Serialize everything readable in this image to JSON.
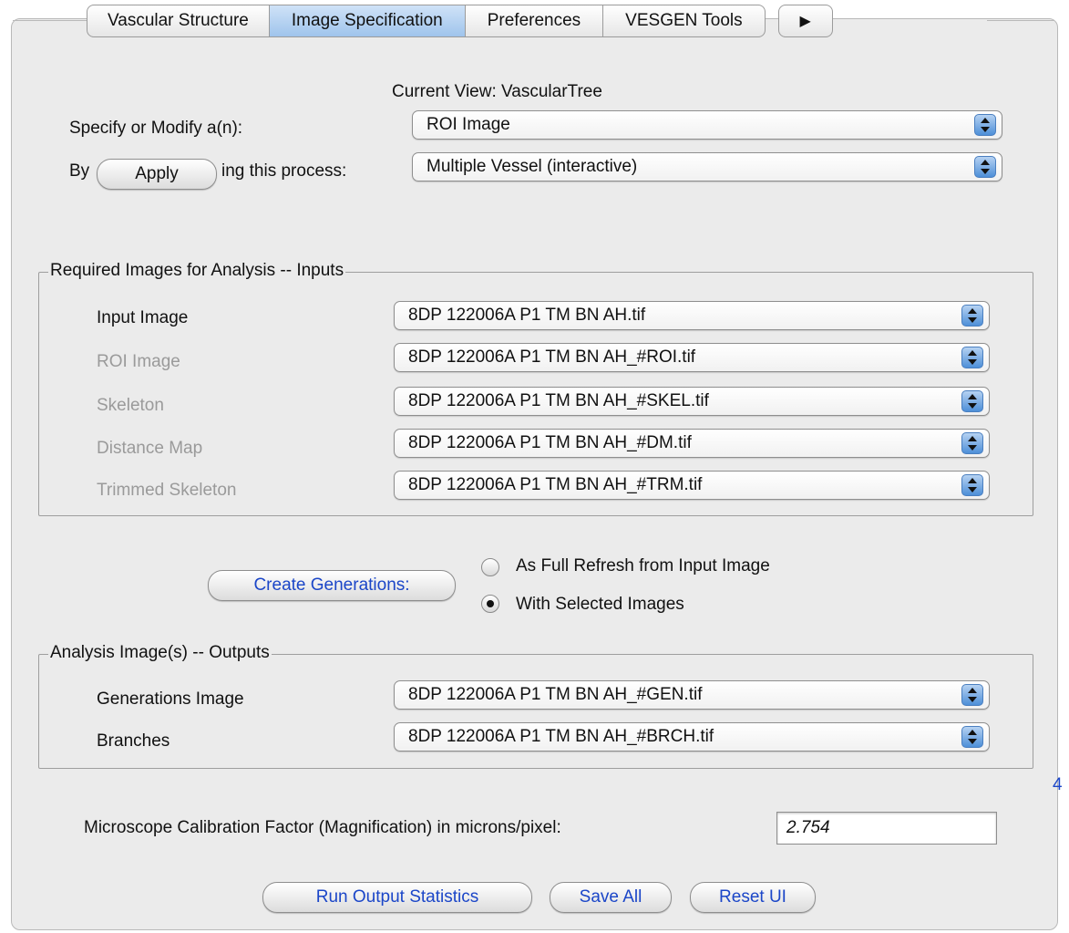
{
  "tabs": [
    "Vascular Structure",
    "Image Specification",
    "Preferences",
    "VESGEN Tools"
  ],
  "current_view": "Current View:  VascularTree",
  "specify_label": "Specify or Modify a(n):",
  "specify_value": "ROI Image",
  "by_label": "By",
  "apply_button": "Apply",
  "process_label": "ing this process:",
  "process_value": "Multiple Vessel (interactive)",
  "inputs": {
    "title": "Required Images for Analysis -- Inputs",
    "rows": [
      {
        "label": "Input Image",
        "value": "8DP 122006A P1 TM BN AH.tif"
      },
      {
        "label": "ROI Image",
        "value": "8DP 122006A P1 TM BN AH_#ROI.tif"
      },
      {
        "label": "Skeleton",
        "value": "8DP 122006A P1 TM BN AH_#SKEL.tif"
      },
      {
        "label": "Distance Map",
        "value": "8DP 122006A P1 TM BN AH_#DM.tif"
      },
      {
        "label": "Trimmed Skeleton",
        "value": "8DP 122006A P1 TM BN AH_#TRM.tif"
      }
    ]
  },
  "create_button": "Create Generations:",
  "radio_full": "As Full Refresh from Input Image",
  "radio_selected": "With Selected Images",
  "outputs": {
    "title": "Analysis Image(s) -- Outputs",
    "rows": [
      {
        "label": "Generations Image",
        "value": "8DP 122006A P1 TM BN AH_#GEN.tif"
      },
      {
        "label": "Branches",
        "value": "8DP 122006A P1 TM BN AH_#BRCH.tif"
      }
    ]
  },
  "side_number": "4",
  "calibration_label": "Microscope Calibration Factor (Magnification) in microns/pixel:",
  "calibration_value": "2.754",
  "buttons": {
    "run": "Run Output Statistics",
    "save": "Save All",
    "reset": "Reset UI"
  }
}
